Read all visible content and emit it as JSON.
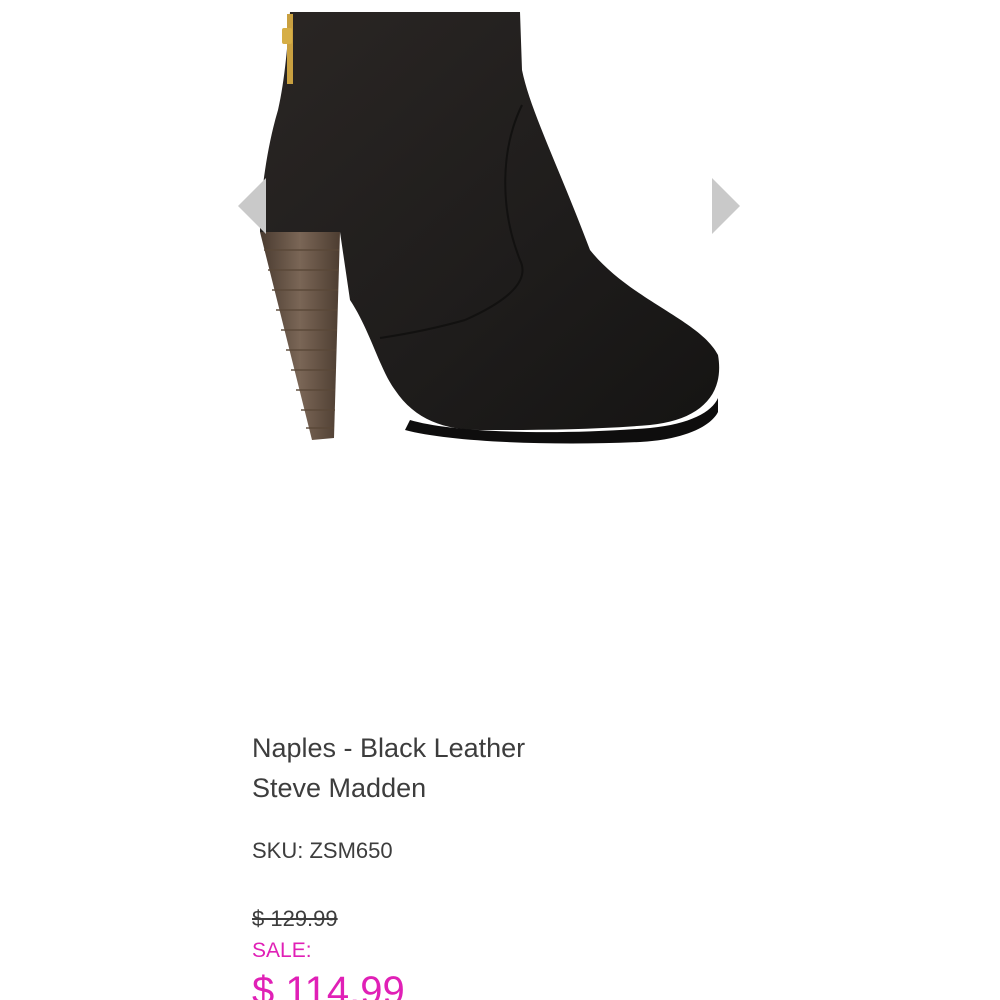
{
  "gallery": {
    "image_name": "black-ankle-bootie-image",
    "prev_icon": "chevron-left-icon",
    "next_icon": "chevron-right-icon",
    "arrow_color": "#c9c9c9"
  },
  "product": {
    "name": "Naples - Black Leather",
    "brand": "Steve Madden",
    "sku": "SKU: ZSM650",
    "original_price": "$ 129.99",
    "sale_label": "SALE:",
    "sale_price": "$ 114.99"
  },
  "colors": {
    "sale": "#e020b6",
    "text": "#3d3d3d"
  }
}
